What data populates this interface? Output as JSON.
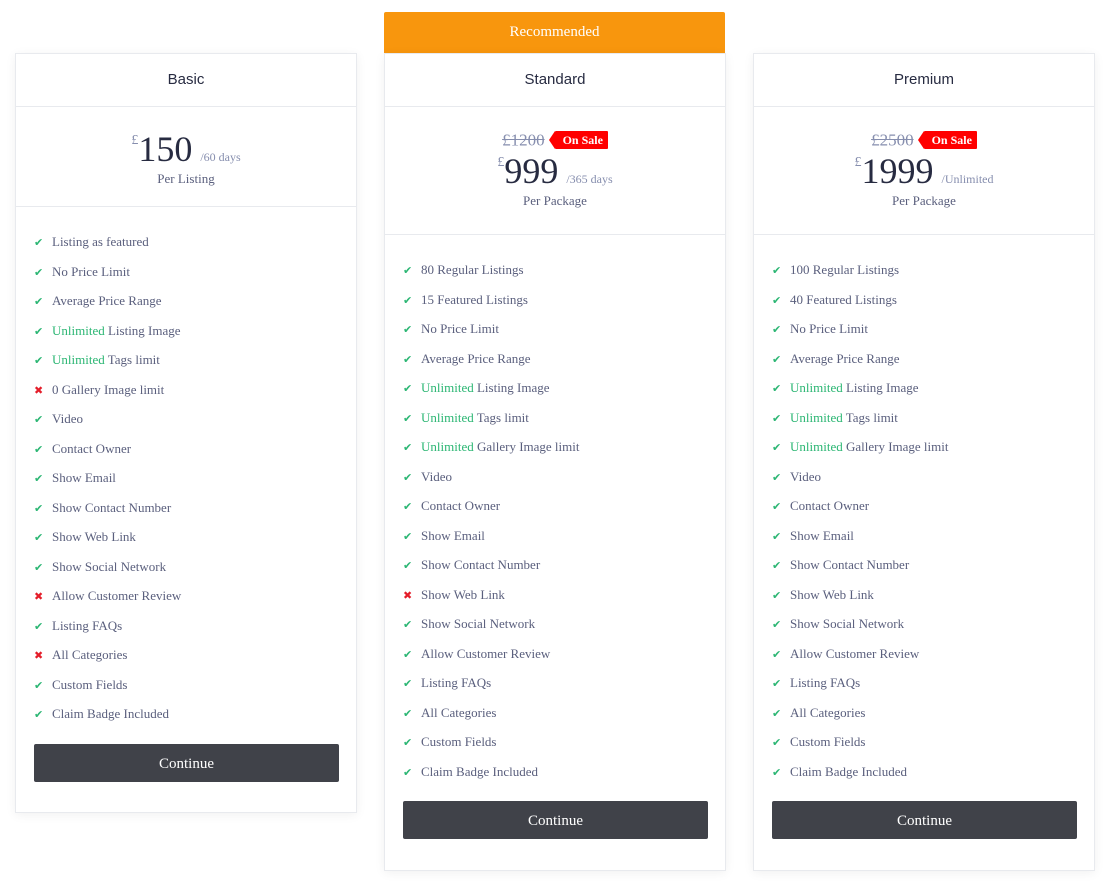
{
  "ribbon": "Recommended",
  "icons": {
    "check": "check-icon",
    "cross": "cross-icon"
  },
  "colors": {
    "ribbon": "#f8960d",
    "sale": "#ff0000",
    "check": "#2bb673",
    "cross": "#e41e2a",
    "button": "#404249"
  },
  "plans": [
    {
      "name": "Basic",
      "currency": "£",
      "price": "150",
      "period": "/60 days",
      "per": "Per Listing",
      "button": "Continue",
      "features": [
        {
          "ok": true,
          "hl": "",
          "text": "Listing as featured"
        },
        {
          "ok": true,
          "hl": "",
          "text": "No Price Limit"
        },
        {
          "ok": true,
          "hl": "",
          "text": "Average Price Range"
        },
        {
          "ok": true,
          "hl": "Unlimited",
          "text": " Listing Image"
        },
        {
          "ok": true,
          "hl": "Unlimited",
          "text": " Tags limit"
        },
        {
          "ok": false,
          "hl": "",
          "text": "0 Gallery Image limit"
        },
        {
          "ok": true,
          "hl": "",
          "text": "Video"
        },
        {
          "ok": true,
          "hl": "",
          "text": "Contact Owner"
        },
        {
          "ok": true,
          "hl": "",
          "text": "Show Email"
        },
        {
          "ok": true,
          "hl": "",
          "text": "Show Contact Number"
        },
        {
          "ok": true,
          "hl": "",
          "text": "Show Web Link"
        },
        {
          "ok": true,
          "hl": "",
          "text": "Show Social Network"
        },
        {
          "ok": false,
          "hl": "",
          "text": "Allow Customer Review"
        },
        {
          "ok": true,
          "hl": "",
          "text": "Listing FAQs"
        },
        {
          "ok": false,
          "hl": "",
          "text": "All Categories"
        },
        {
          "ok": true,
          "hl": "",
          "text": "Custom Fields"
        },
        {
          "ok": true,
          "hl": "",
          "text": "Claim Badge Included"
        }
      ]
    },
    {
      "name": "Standard",
      "old_price": "£1200",
      "sale_label": "On Sale",
      "currency": "£",
      "price": "999",
      "period": "/365 days",
      "per": "Per Package",
      "button": "Continue",
      "features": [
        {
          "ok": true,
          "hl": "",
          "text": "80 Regular Listings"
        },
        {
          "ok": true,
          "hl": "",
          "text": "15 Featured Listings"
        },
        {
          "ok": true,
          "hl": "",
          "text": "No Price Limit"
        },
        {
          "ok": true,
          "hl": "",
          "text": "Average Price Range"
        },
        {
          "ok": true,
          "hl": "Unlimited",
          "text": " Listing Image"
        },
        {
          "ok": true,
          "hl": "Unlimited",
          "text": " Tags limit"
        },
        {
          "ok": true,
          "hl": "Unlimited",
          "text": " Gallery Image limit"
        },
        {
          "ok": true,
          "hl": "",
          "text": "Video"
        },
        {
          "ok": true,
          "hl": "",
          "text": "Contact Owner"
        },
        {
          "ok": true,
          "hl": "",
          "text": "Show Email"
        },
        {
          "ok": true,
          "hl": "",
          "text": "Show Contact Number"
        },
        {
          "ok": false,
          "hl": "",
          "text": "Show Web Link"
        },
        {
          "ok": true,
          "hl": "",
          "text": "Show Social Network"
        },
        {
          "ok": true,
          "hl": "",
          "text": "Allow Customer Review"
        },
        {
          "ok": true,
          "hl": "",
          "text": "Listing FAQs"
        },
        {
          "ok": true,
          "hl": "",
          "text": "All Categories"
        },
        {
          "ok": true,
          "hl": "",
          "text": "Custom Fields"
        },
        {
          "ok": true,
          "hl": "",
          "text": "Claim Badge Included"
        }
      ]
    },
    {
      "name": "Premium",
      "old_price": "£2500",
      "sale_label": "On Sale",
      "currency": "£",
      "price": "1999",
      "period": "/Unlimited",
      "per": "Per Package",
      "button": "Continue",
      "features": [
        {
          "ok": true,
          "hl": "",
          "text": "100 Regular Listings"
        },
        {
          "ok": true,
          "hl": "",
          "text": "40 Featured Listings"
        },
        {
          "ok": true,
          "hl": "",
          "text": "No Price Limit"
        },
        {
          "ok": true,
          "hl": "",
          "text": "Average Price Range"
        },
        {
          "ok": true,
          "hl": "Unlimited",
          "text": " Listing Image"
        },
        {
          "ok": true,
          "hl": "Unlimited",
          "text": " Tags limit"
        },
        {
          "ok": true,
          "hl": "Unlimited",
          "text": " Gallery Image limit"
        },
        {
          "ok": true,
          "hl": "",
          "text": "Video"
        },
        {
          "ok": true,
          "hl": "",
          "text": "Contact Owner"
        },
        {
          "ok": true,
          "hl": "",
          "text": "Show Email"
        },
        {
          "ok": true,
          "hl": "",
          "text": "Show Contact Number"
        },
        {
          "ok": true,
          "hl": "",
          "text": "Show Web Link"
        },
        {
          "ok": true,
          "hl": "",
          "text": "Show Social Network"
        },
        {
          "ok": true,
          "hl": "",
          "text": "Allow Customer Review"
        },
        {
          "ok": true,
          "hl": "",
          "text": "Listing FAQs"
        },
        {
          "ok": true,
          "hl": "",
          "text": "All Categories"
        },
        {
          "ok": true,
          "hl": "",
          "text": "Custom Fields"
        },
        {
          "ok": true,
          "hl": "",
          "text": "Claim Badge Included"
        }
      ]
    }
  ]
}
